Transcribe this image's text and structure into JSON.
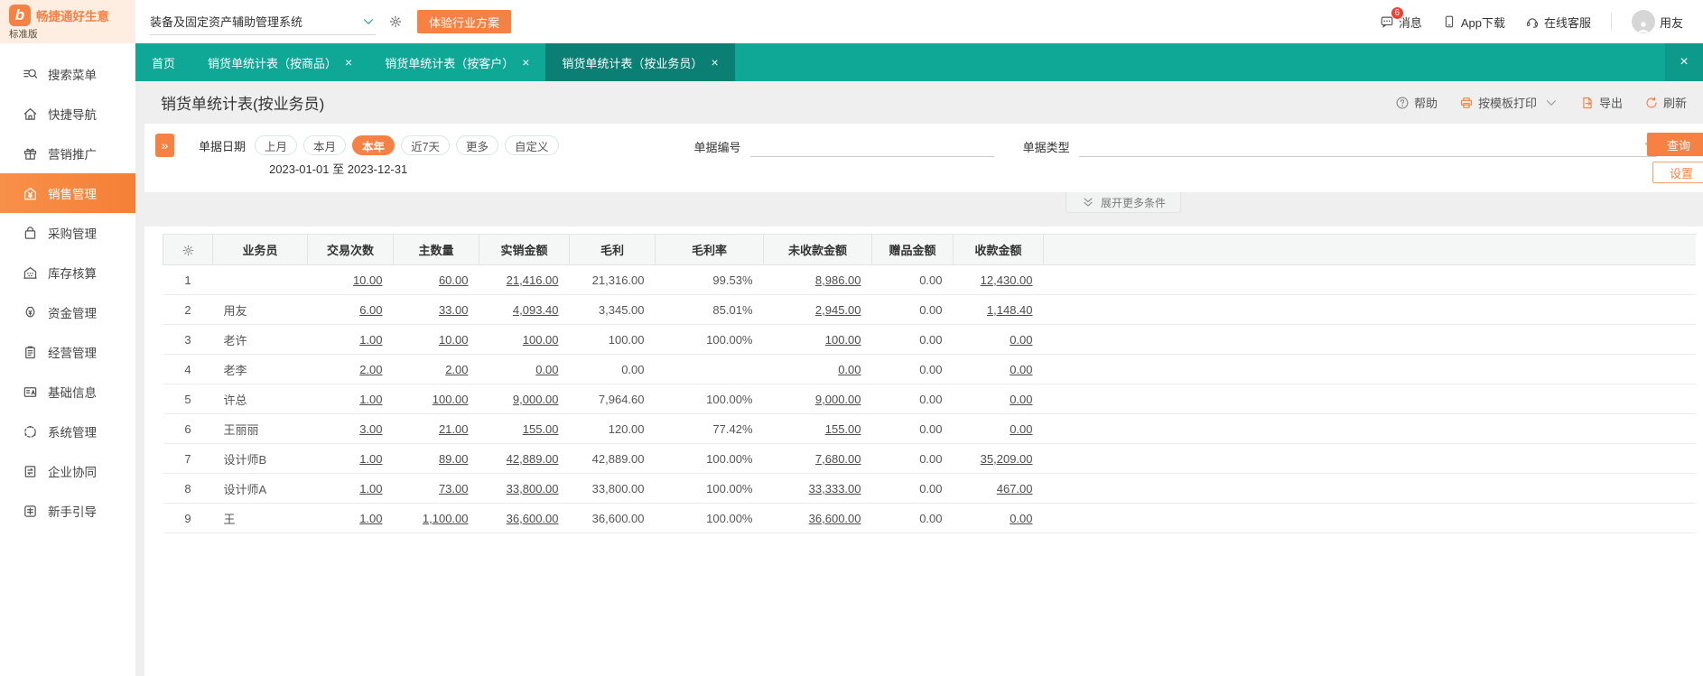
{
  "colors": {
    "teal": "#0fa897",
    "teal_dark": "#0b7f73",
    "orange": "#f78142",
    "badge_red": "#f04134",
    "sidebar_active": "#f78a43"
  },
  "topbar": {
    "brand": {
      "name": "畅捷通好生意",
      "edition": "标准版",
      "logo_letter": "b"
    },
    "system_select": "装备及固定资产辅助管理系统",
    "try_button": "体验行业方案",
    "right": {
      "messages": "消息",
      "messages_badge": "6",
      "app_download": "App下载",
      "online_service": "在线客服",
      "user": "用友"
    }
  },
  "tab_bar": {
    "tabs": [
      {
        "label": "首页",
        "closable": false,
        "active": false
      },
      {
        "label": "销货单统计表（按商品）",
        "closable": true,
        "active": false
      },
      {
        "label": "销货单统计表（按客户）",
        "closable": true,
        "active": false
      },
      {
        "label": "销货单统计表（按业务员）",
        "closable": true,
        "active": true
      }
    ],
    "close_all_icon": "close-icon"
  },
  "sidebar": {
    "items": [
      {
        "label": "搜索菜单",
        "icon": "search-menu-icon",
        "active": false
      },
      {
        "label": "快捷导航",
        "icon": "home-icon",
        "active": false
      },
      {
        "label": "营销推广",
        "icon": "gift-icon",
        "active": false
      },
      {
        "label": "销售管理",
        "icon": "sales-house-icon",
        "active": true
      },
      {
        "label": "采购管理",
        "icon": "shopping-bag-icon",
        "active": false
      },
      {
        "label": "库存核算",
        "icon": "warehouse-icon",
        "active": false
      },
      {
        "label": "资金管理",
        "icon": "money-bag-icon",
        "active": false
      },
      {
        "label": "经营管理",
        "icon": "clipboard-icon",
        "active": false
      },
      {
        "label": "基础信息",
        "icon": "info-card-icon",
        "active": false
      },
      {
        "label": "系统管理",
        "icon": "system-icon",
        "active": false
      },
      {
        "label": "企业协同",
        "icon": "collab-icon",
        "active": false
      },
      {
        "label": "新手引导",
        "icon": "guide-icon",
        "active": false
      }
    ]
  },
  "page": {
    "title": "销货单统计表(按业务员)",
    "toolbar": {
      "help": "帮助",
      "print": "按模板打印",
      "export": "导出",
      "refresh": "刷新"
    }
  },
  "filters": {
    "date_label": "单据日期",
    "date_options": [
      "上月",
      "本月",
      "本年",
      "近7天",
      "更多",
      "自定义"
    ],
    "date_active": "本年",
    "date_range": "2023-01-01 至 2023-12-31",
    "doc_no_label": "单据编号",
    "doc_no_value": "",
    "doc_type_label": "单据类型",
    "doc_type_value": "",
    "search_button": "查询",
    "settings_button": "设置",
    "expand_more": "展开更多条件"
  },
  "table": {
    "settings_icon": "gear-icon",
    "columns": [
      "业务员",
      "交易次数",
      "主数量",
      "实销金额",
      "毛利",
      "毛利率",
      "未收款金额",
      "赠品金额",
      "收款金额"
    ],
    "link_column_indexes": [
      0,
      1,
      2,
      5,
      7
    ],
    "rows": [
      {
        "no": "1",
        "salesperson": "",
        "values": [
          "10.00",
          "60.00",
          "21,416.00",
          "21,316.00",
          "99.53%",
          "8,986.00",
          "0.00",
          "12,430.00"
        ]
      },
      {
        "no": "2",
        "salesperson": "用友",
        "values": [
          "6.00",
          "33.00",
          "4,093.40",
          "3,345.00",
          "85.01%",
          "2,945.00",
          "0.00",
          "1,148.40"
        ]
      },
      {
        "no": "3",
        "salesperson": "老许",
        "values": [
          "1.00",
          "10.00",
          "100.00",
          "100.00",
          "100.00%",
          "100.00",
          "0.00",
          "0.00"
        ]
      },
      {
        "no": "4",
        "salesperson": "老李",
        "values": [
          "2.00",
          "2.00",
          "0.00",
          "0.00",
          "",
          "0.00",
          "0.00",
          "0.00"
        ]
      },
      {
        "no": "5",
        "salesperson": "许总",
        "values": [
          "1.00",
          "100.00",
          "9,000.00",
          "7,964.60",
          "100.00%",
          "9,000.00",
          "0.00",
          "0.00"
        ]
      },
      {
        "no": "6",
        "salesperson": "王丽丽",
        "values": [
          "3.00",
          "21.00",
          "155.00",
          "120.00",
          "77.42%",
          "155.00",
          "0.00",
          "0.00"
        ]
      },
      {
        "no": "7",
        "salesperson": "设计师B",
        "values": [
          "1.00",
          "89.00",
          "42,889.00",
          "42,889.00",
          "100.00%",
          "7,680.00",
          "0.00",
          "35,209.00"
        ]
      },
      {
        "no": "8",
        "salesperson": "设计师A",
        "values": [
          "1.00",
          "73.00",
          "33,800.00",
          "33,800.00",
          "100.00%",
          "33,333.00",
          "0.00",
          "467.00"
        ]
      },
      {
        "no": "9",
        "salesperson": "王",
        "values": [
          "1.00",
          "1,100.00",
          "36,600.00",
          "36,600.00",
          "100.00%",
          "36,600.00",
          "0.00",
          "0.00"
        ]
      }
    ]
  }
}
